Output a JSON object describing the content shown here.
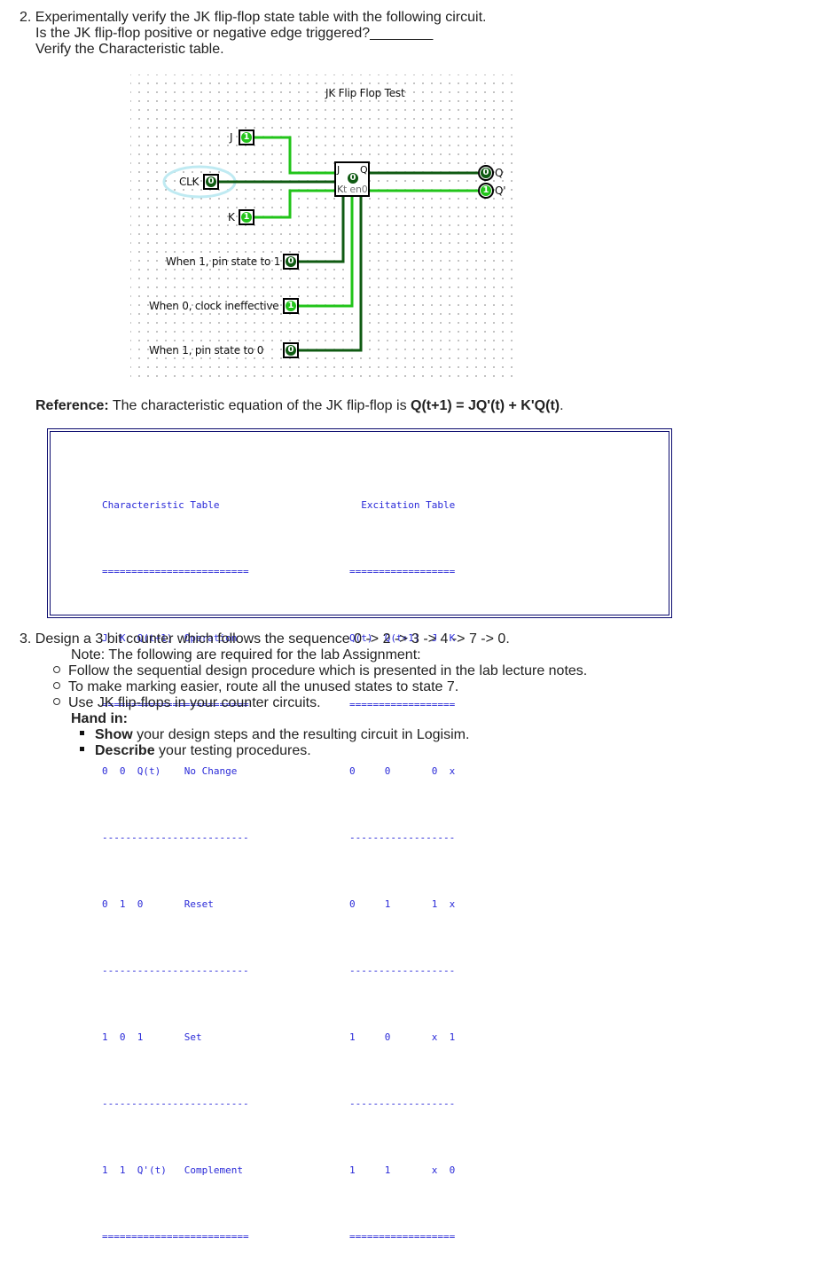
{
  "section2": {
    "line1": "2. Experimentally verify the JK flip-flop state table with the following circuit.",
    "line2": "Is the JK flip-flop positive or negative edge triggered?________",
    "line3": "Verify the Characteristic table."
  },
  "circuit": {
    "title": "JK Flip Flop Test",
    "inputs": {
      "j": {
        "label": "J",
        "value": "1"
      },
      "clk": {
        "label": "CLK",
        "value": "0"
      },
      "k": {
        "label": "K",
        "value": "1"
      }
    },
    "flipflop": {
      "label_j": "J",
      "label_q": "Q",
      "label_k": "K",
      "label_en": "t en0",
      "state": "0"
    },
    "outputs": {
      "q": {
        "label": "Q",
        "value": "0"
      },
      "qn": {
        "label": "Q'",
        "value": "1"
      }
    },
    "controls": [
      {
        "label": "When 1, pin state to 1",
        "value": "0"
      },
      {
        "label": "When 0, clock ineffective",
        "value": "1"
      },
      {
        "label": "When 1, pin state to 0",
        "value": "0"
      }
    ],
    "colors": {
      "wire_on": "#22c41a",
      "wire_off": "#0f5a12",
      "clk_highlight": "#bfeaf2"
    }
  },
  "reference": {
    "label": "Reference:",
    "text": " The characteristic equation of the JK flip-flop is ",
    "equation": "Q(t+1) = JQ'(t) + K'Q(t)",
    "end": "."
  },
  "characteristic_table": {
    "title": "Characteristic Table",
    "rule_double": "=========================",
    "rule_single": "-------------------------",
    "header": "J  K  Q(t+1)  Operation",
    "rows": [
      "0  0  Q(t)    No Change",
      "0  1  0       Reset",
      "1  0  1       Set",
      "1  1  Q'(t)   Complement"
    ]
  },
  "excitation_table": {
    "title": "  Excitation Table",
    "rule_double": "==================",
    "rule_single": "------------------",
    "header": "Q(t)  Q(t+1)  J  K",
    "rows": [
      "0     0       0  x",
      "0     1       1  x",
      "1     0       x  1",
      "1     1       x  0"
    ]
  },
  "section3": {
    "heading": "3. Design a 3 bit counter which follows the sequence 0 -> 2 -> 3 -> 4 -> 7 -> 0.",
    "note": "Note: The following are required for the lab Assignment:",
    "bullets": [
      "Follow the sequential design procedure which is presented in the lab lecture notes.",
      "To make marking easier, route all the unused states to state 7.",
      "Use JK flip-flops in your counter circuits."
    ],
    "hand_in_label": "Hand in:",
    "hand_in_items": [
      {
        "bold": "Show",
        "text": " your design steps and the resulting circuit in Logisim."
      },
      {
        "bold": "Describe",
        "text": " your testing procedures."
      }
    ]
  }
}
